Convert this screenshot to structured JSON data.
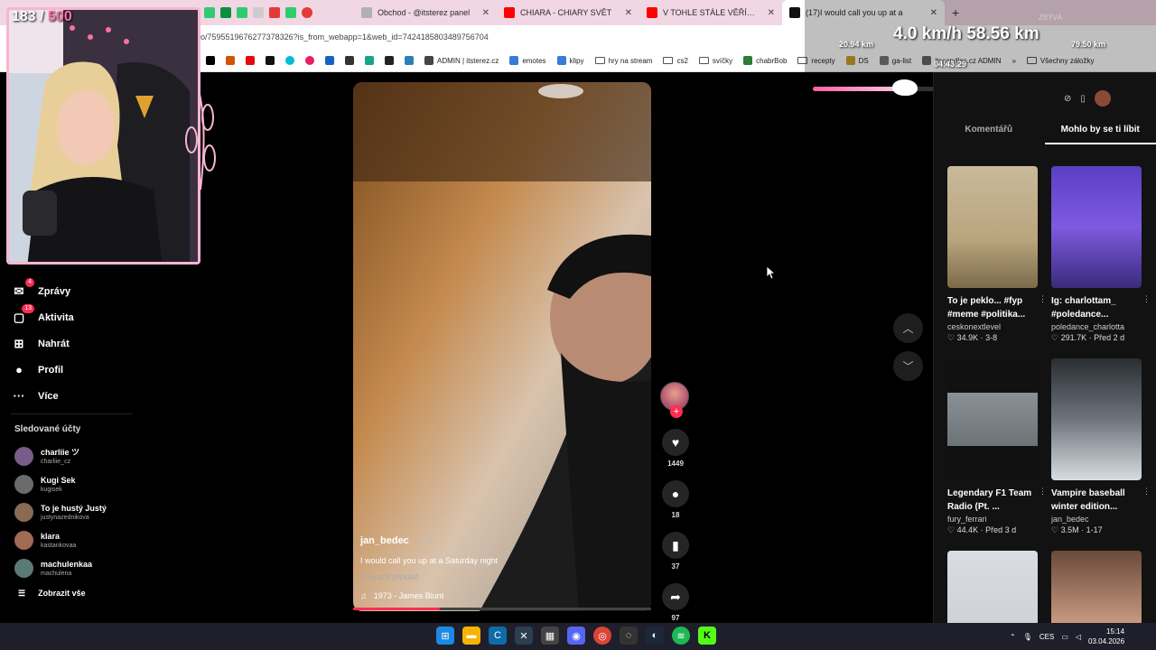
{
  "browser": {
    "tabs": [
      {
        "label": "Obchod - @itsterez panel",
        "color": "#b0b0b0"
      },
      {
        "label": "CHIARA - CHIARY SVĚT",
        "color": "#ff0000"
      },
      {
        "label": "V TOHLE STÁLE VĚŘÍŠ? TOP MY",
        "color": "#ff0000"
      },
      {
        "label": "(17)I would call you up at a",
        "color": "#111111"
      }
    ],
    "new_tab": "+",
    "address": "o/7595519676277378326?is_from_webapp=1&web_id=7424185803489756704",
    "bookmarks": [
      {
        "label": "ADMIN | itsterez.cz",
        "color": "#444444"
      },
      {
        "label": "emotes",
        "color": "#3a7bd5"
      },
      {
        "label": "klipy",
        "color": "#3a7bd5"
      },
      {
        "label": "hry na stream",
        "type": "folder"
      },
      {
        "label": "cs2",
        "type": "folder"
      },
      {
        "label": "svíčky",
        "type": "folder"
      },
      {
        "label": "chabrBob",
        "color": "#2e7d32"
      },
      {
        "label": "recepty",
        "type": "folder"
      },
      {
        "label": "DS",
        "color": "#c9a227"
      },
      {
        "label": "ga-list",
        "color": "#777777"
      },
      {
        "label": "itscandles.cz ADMIN",
        "color": "#666666"
      },
      {
        "label": "»",
        "type": "text"
      },
      {
        "label": "Všechny záložky",
        "type": "folder"
      }
    ]
  },
  "sidebar": {
    "nav": [
      {
        "label": "Zprávy",
        "icon": "messages-icon",
        "glyph": "✉",
        "badge": "4"
      },
      {
        "label": "Aktivita",
        "icon": "activity-icon",
        "glyph": "▢",
        "badge": "13"
      },
      {
        "label": "Nahrát",
        "icon": "upload-icon",
        "glyph": "⊞",
        "badge": ""
      },
      {
        "label": "Profil",
        "icon": "profile-icon",
        "glyph": "●",
        "badge": ""
      },
      {
        "label": "Více",
        "icon": "more-icon",
        "glyph": "···",
        "badge": ""
      }
    ],
    "following_title": "Sledované účty",
    "following": [
      {
        "name": "charliie ツ",
        "user": "charliie_cz",
        "color": "#7a5c8a"
      },
      {
        "name": "Kugi Sek",
        "user": "kugisek",
        "color": "#6b6b6b"
      },
      {
        "name": "To je hustý Justý",
        "user": "justynazednikova",
        "color": "#8a6a50"
      },
      {
        "name": "klara",
        "user": "kastankovaa",
        "color": "#a06a55"
      },
      {
        "name": "machulenkaa",
        "user": "machulena",
        "color": "#5a7a78"
      }
    ],
    "show_all": "Zobrazit vše"
  },
  "video": {
    "author": "jan_bedec",
    "date": "· 1-15",
    "caption": "I would call you up at a Saturday night",
    "translate": "Zobrazit překlad",
    "music": "1973 - James Blunt",
    "progress": 0.29,
    "likes": "1449",
    "comments": "18",
    "saves": "37",
    "shares": "97"
  },
  "right_panel": {
    "tabs": [
      "Komentářů",
      "Mohlo by se ti líbit"
    ],
    "recs": [
      {
        "title": "To je peklo... #fyp #meme #politika...",
        "user": "ceskonextlevel",
        "stats": "♡ 34.9K · 3-8",
        "thumb": "linear-gradient(180deg,#c9b99a 0%,#b9a57e 60%,#7c6a4a 100%)"
      },
      {
        "title": "Ig: charlottam_ #poledance...",
        "user": "poledance_charlotta",
        "stats": "♡ 291.7K · Před 2 d",
        "thumb": "linear-gradient(180deg,#5b3fc2 0%,#7e5ae0 50%,#3a2b7a 100%)"
      },
      {
        "title": "Legendary F1 Team Radio (Pt. ...",
        "user": "fury_ferrari",
        "stats": "♡ 44.4K · Před 3 d",
        "thumb": "linear-gradient(180deg,#111 0%,#111 28%,#8a9196 28%,#6b7377 72%,#111 72%)"
      },
      {
        "title": "Vampire baseball winter edition...",
        "user": "jan_bedec",
        "stats": "♡ 3.5M · 1-17",
        "thumb": "linear-gradient(180deg,#2a2e33 0%,#6d747b 50%,#d8dde2 100%)"
      },
      {
        "title": "",
        "user": "",
        "stats": "",
        "thumb": "linear-gradient(180deg,#d9dde2 0%,#c7ccd1 100%)"
      },
      {
        "title": "",
        "user": "",
        "stats": "",
        "thumb": "linear-gradient(180deg,#6a4a3a 0%,#c89a80 60%,#e0c0a8 100%)"
      }
    ]
  },
  "overlay": {
    "sub_count": "183",
    "sub_sep": " / ",
    "sub_goal": "500",
    "speed": "4.0 km/h",
    "distance": "58.56 km",
    "left_km": "20.94 km",
    "right_km": "79.50 km",
    "time": "04:43:29",
    "hint": "ZBÝVÁ",
    "progress": 0.28
  },
  "taskbar": {
    "lang": "CES",
    "time": "15:14",
    "date": "03.04.2026"
  },
  "colors": {
    "accent": "#fe2c55",
    "overlay_pink": "#f7b6cf"
  }
}
